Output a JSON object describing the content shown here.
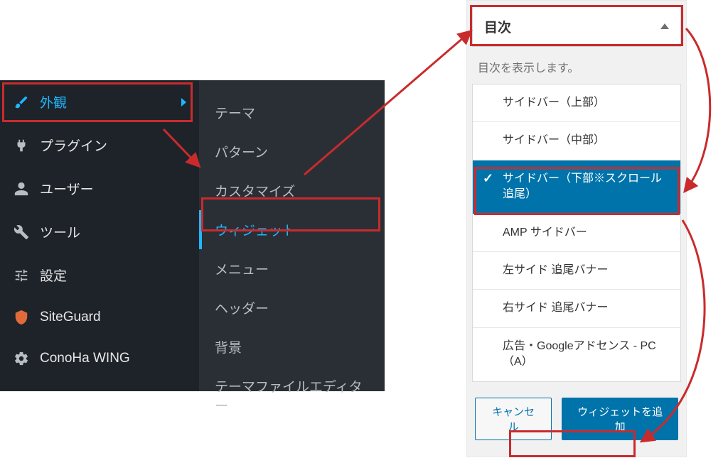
{
  "sidebar": {
    "items": [
      {
        "label": "外観",
        "icon": "brush-icon",
        "current": true
      },
      {
        "label": "プラグイン",
        "icon": "plug-icon"
      },
      {
        "label": "ユーザー",
        "icon": "user-icon"
      },
      {
        "label": "ツール",
        "icon": "wrench-icon"
      },
      {
        "label": "設定",
        "icon": "sliders-icon"
      },
      {
        "label": "SiteGuard",
        "icon": "shield-icon"
      },
      {
        "label": "ConoHa WING",
        "icon": "gear-icon"
      }
    ]
  },
  "submenu": {
    "items": [
      {
        "label": "テーマ"
      },
      {
        "label": "パターン"
      },
      {
        "label": "カスタマイズ"
      },
      {
        "label": "ウィジェット",
        "current": true
      },
      {
        "label": "メニュー"
      },
      {
        "label": "ヘッダー"
      },
      {
        "label": "背景"
      },
      {
        "label": "テーマファイルエディター"
      }
    ]
  },
  "widget": {
    "title": "目次",
    "description": "目次を表示します。",
    "areas": [
      {
        "label": "サイドバー（上部）"
      },
      {
        "label": "サイドバー（中部）"
      },
      {
        "label": "サイドバー（下部※スクロール追尾）",
        "selected": true
      },
      {
        "label": "AMP サイドバー"
      },
      {
        "label": "左サイド 追尾バナー"
      },
      {
        "label": "右サイド 追尾バナー"
      },
      {
        "label": "広告・Googleアドセンス - PC（A）"
      }
    ],
    "cancel_label": "キャンセル",
    "add_label": "ウィジェットを追加"
  },
  "annotation": {
    "color": "#c92b2d"
  }
}
